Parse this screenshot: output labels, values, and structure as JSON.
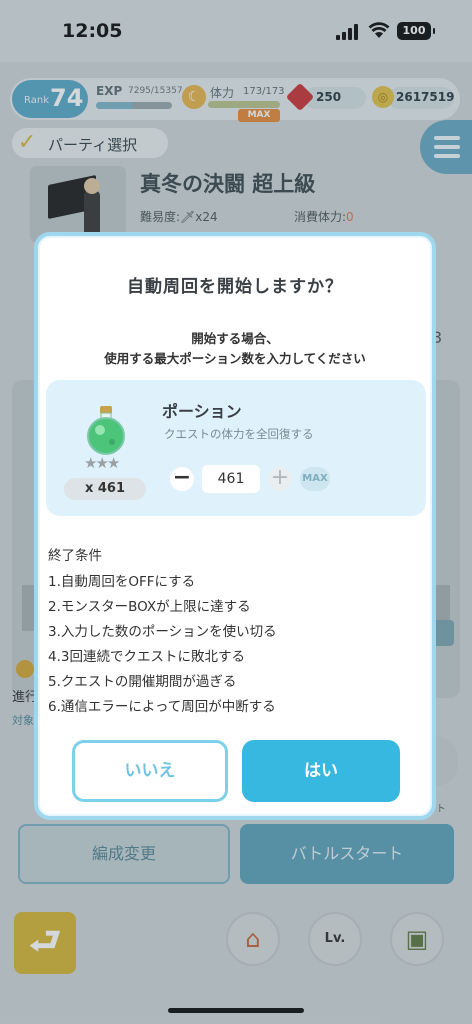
{
  "status_bar": {
    "time": "12:05",
    "battery": "100"
  },
  "hud": {
    "rank_label": "Rank",
    "rank": "74",
    "exp_label": "EXP",
    "exp_value": "7295/15357",
    "exp_fraction": 0.475,
    "stamina_label": "体力",
    "stamina_value": "173/173",
    "stamina_max_tag": "MAX",
    "gems": "250",
    "coins": "2617519"
  },
  "party": {
    "label": "パーティ選択"
  },
  "quest": {
    "title": "真冬の決闘 超上級",
    "difficulty": "難易度:🗡x24",
    "stamina_cost_label": "消費体力:",
    "stamina_cost_value": "0"
  },
  "background": {
    "peek_number": "3",
    "progress_label": "進行",
    "target_label": "対象",
    "right_note": "ト"
  },
  "dialog": {
    "title": "自動周回を開始しますか？",
    "subtitle_line1": "開始する場合、",
    "subtitle_line2": "使用する最大ポーション数を入力してください",
    "potion": {
      "name": "ポーション",
      "description": "クエストの体力を全回復する",
      "owned": "x 461",
      "stars": "★★★",
      "quantity": "461",
      "max_label": "MAX",
      "minus_label": "−",
      "plus_label": "+"
    },
    "conditions_title": "終了条件",
    "conditions": [
      "1.自動周回をOFFにする",
      "2.モンスターBOXが上限に達する",
      "3.入力した数のポーションを使い切る",
      "4.3回連続でクエストに敗北する",
      "5.クエストの開催期間が過ぎる",
      "6.通信エラーによって周回が中断する"
    ],
    "no_label": "いいえ",
    "yes_label": "はい"
  },
  "bottom": {
    "edit_label": "編成変更",
    "battle_label": "バトルスタート",
    "back_icon": "back-arrow-icon",
    "lv_label": "Lv."
  },
  "colors": {
    "accent": "#36b8e0",
    "dialog_border": "#9fd7ef",
    "potion_card": "#dff2fb",
    "gold": "#d5b53a"
  }
}
